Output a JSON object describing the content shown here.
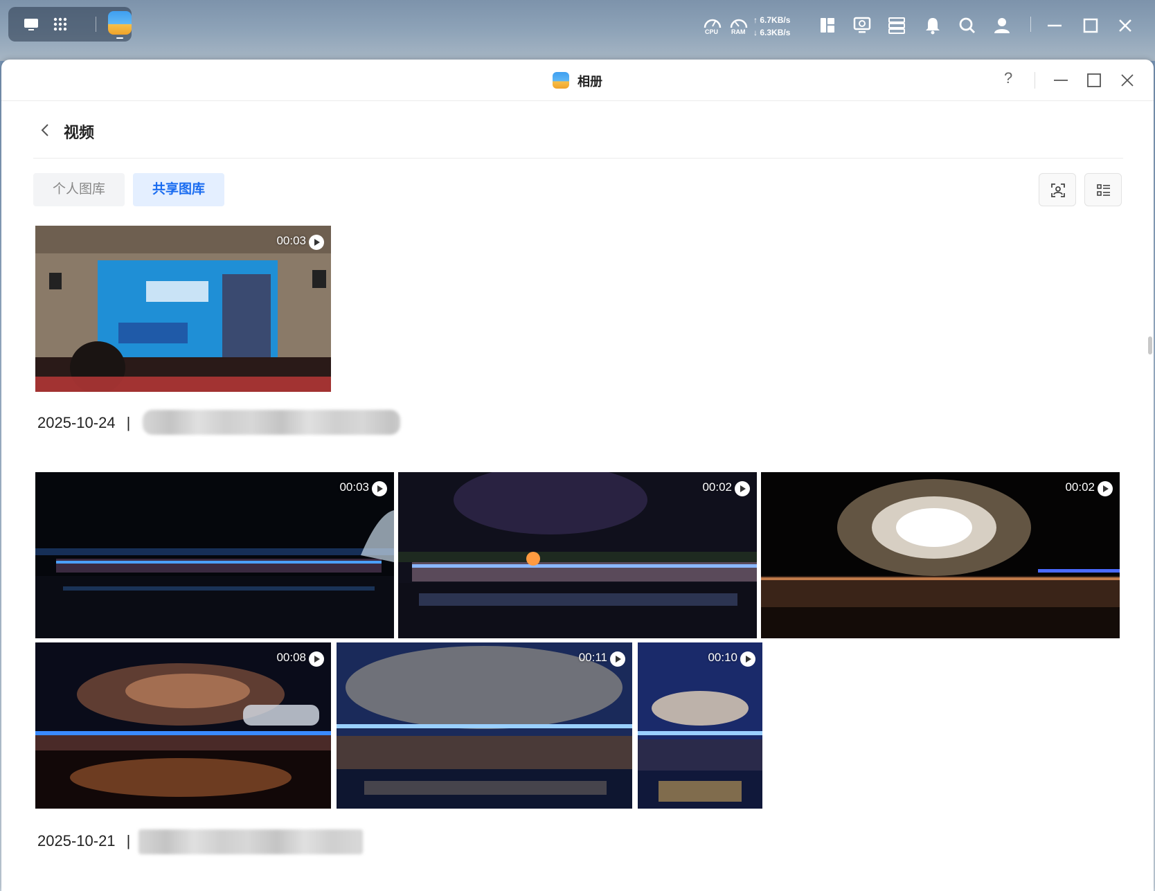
{
  "taskbar": {
    "cpu_label": "CPU",
    "ram_label": "RAM",
    "upload": "6.7KB/s",
    "download": "6.3KB/s",
    "up_arrow": "↑",
    "down_arrow": "↓"
  },
  "window": {
    "title": "相册",
    "help": "?"
  },
  "page": {
    "title": "视频"
  },
  "tabs": [
    {
      "label": "个人图库",
      "active": false
    },
    {
      "label": "共享图库",
      "active": true
    }
  ],
  "groups": [
    {
      "date": "",
      "videos": [
        {
          "duration": "00:03"
        }
      ]
    },
    {
      "date": "2025-10-24",
      "separator": "|",
      "videos": [
        {
          "duration": "00:03"
        },
        {
          "duration": "00:02"
        },
        {
          "duration": "00:02"
        },
        {
          "duration": "00:08"
        },
        {
          "duration": "00:11"
        },
        {
          "duration": "00:10"
        }
      ]
    },
    {
      "date": "2025-10-21",
      "separator": "|",
      "videos": []
    }
  ],
  "colors": {
    "accent": "#1a6cf0",
    "tab_active_bg": "#e4efff"
  }
}
